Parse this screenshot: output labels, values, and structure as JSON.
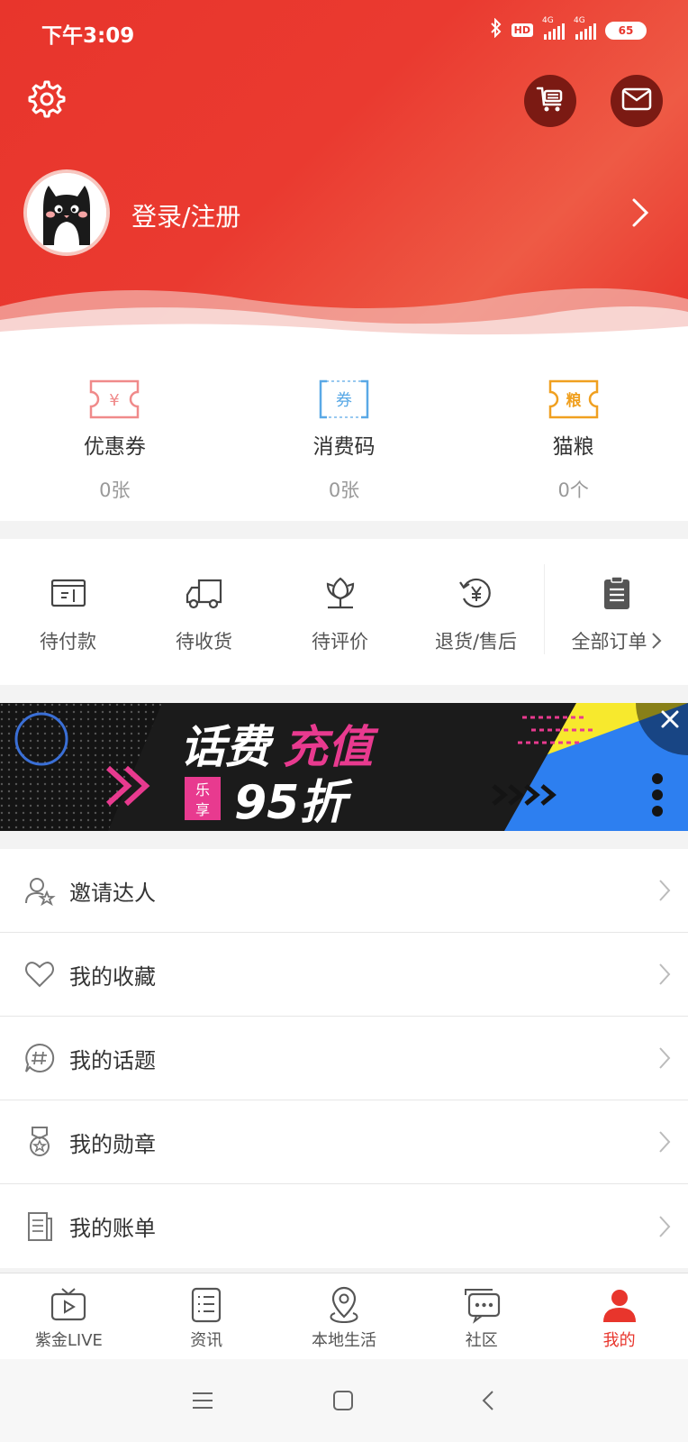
{
  "status_bar": {
    "time": "下午3:09",
    "hd": "HD",
    "net1": "4G",
    "net2": "4G",
    "battery": "65"
  },
  "header": {
    "login_label": "登录/注册",
    "accent_color": "#e8352c"
  },
  "assets": [
    {
      "label": "优惠券",
      "value": "0张",
      "icon": "coupon-icon",
      "icon_text": "¥",
      "color": "#f08a8a"
    },
    {
      "label": "消费码",
      "value": "0张",
      "icon": "voucher-code-icon",
      "icon_text": "券",
      "color": "#5aa9e6"
    },
    {
      "label": "猫粮",
      "value": "0个",
      "icon": "cat-food-icon",
      "icon_text": "粮",
      "color": "#f0a020"
    }
  ],
  "orders": [
    {
      "label": "待付款",
      "icon": "wallet-icon"
    },
    {
      "label": "待收货",
      "icon": "truck-icon"
    },
    {
      "label": "待评价",
      "icon": "flower-icon"
    },
    {
      "label": "退货/售后",
      "icon": "refund-icon"
    }
  ],
  "orders_all": {
    "label": "全部订单",
    "icon": "clipboard-icon"
  },
  "banner": {
    "line1a": "话费",
    "line1b": "充值",
    "badge_top": "乐",
    "badge_bottom": "享",
    "line2": "95折"
  },
  "menu": [
    {
      "label": "邀请达人",
      "icon": "invite-icon"
    },
    {
      "label": "我的收藏",
      "icon": "heart-icon"
    },
    {
      "label": "我的话题",
      "icon": "topic-icon"
    },
    {
      "label": "我的勋章",
      "icon": "medal-icon"
    },
    {
      "label": "我的账单",
      "icon": "bill-icon"
    }
  ],
  "tabs": [
    {
      "label": "紫金LIVE",
      "icon": "tv-icon",
      "active": false
    },
    {
      "label": "资讯",
      "icon": "news-icon",
      "active": false
    },
    {
      "label": "本地生活",
      "icon": "location-icon",
      "active": false
    },
    {
      "label": "社区",
      "icon": "chat-icon",
      "active": false
    },
    {
      "label": "我的",
      "icon": "user-icon",
      "active": true
    }
  ]
}
